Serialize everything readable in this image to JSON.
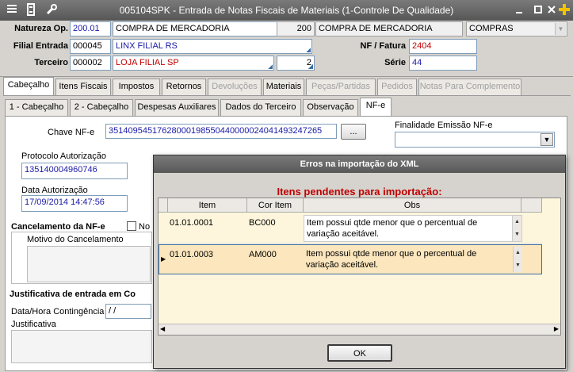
{
  "window": {
    "title": "005104SPK - Entrada de Notas Fiscais de Materiais (1-Controle De Qualidade)"
  },
  "header": {
    "natureza_label": "Natureza Op.",
    "natureza_code": "200.01",
    "natureza_desc": "COMPRA DE MERCADORIA",
    "natureza_num": "200",
    "natureza_desc2": "COMPRA DE MERCADORIA",
    "tipo_value": "COMPRAS",
    "filial_label": "Filial Entrada",
    "filial_code": "000045",
    "filial_name": "LINX FILIAL RS",
    "nf_label": "NF / Fatura",
    "nf_value": "2404",
    "terceiro_label": "Terceiro",
    "terceiro_code": "000002",
    "terceiro_name": "LOJA FILIAL SP",
    "terceiro_num": "2",
    "serie_label": "Série",
    "serie_value": "44"
  },
  "main_tabs": [
    {
      "label": "Cabeçalho"
    },
    {
      "label": "Itens Fiscais"
    },
    {
      "label": "Impostos"
    },
    {
      "label": "Retornos"
    },
    {
      "label": "Devoluções"
    },
    {
      "label": "Materiais"
    },
    {
      "label": "Peças/Partidas"
    },
    {
      "label": "Pedidos"
    },
    {
      "label": "Notas Para Complemento"
    }
  ],
  "sub_tabs": [
    {
      "label": "1 - Cabeçalho"
    },
    {
      "label": "2 - Cabeçalho"
    },
    {
      "label": "Despesas Auxiliares"
    },
    {
      "label": "Dados do Terceiro"
    },
    {
      "label": "Observação"
    },
    {
      "label": "NF-e"
    }
  ],
  "nfe": {
    "chave_label": "Chave NF-e",
    "chave_value": "35140954517628000198550440000024041493247265",
    "chave_button": "...",
    "finalidade_label": "Finalidade Emissão NF-e",
    "protocolo_label": "Protocolo Autorização",
    "protocolo_value": "135140004960746",
    "data_aut_label": "Data Autorização",
    "data_aut_value": "17/09/2014 14:47:56",
    "cancel_label": "Cancelamento da NF-e",
    "cancel_chk_label": "No",
    "motivo_label": "Motivo do Cancelamento",
    "justificativa_title": "Justificativa de entrada em Co",
    "contingencia_label": "Data/Hora Contingência",
    "contingencia_value": " / /",
    "justificativa_label": "Justificativa"
  },
  "dialog": {
    "title": "Erros na importação do XML",
    "heading": "Itens pendentes para importação:",
    "columns": [
      "Item",
      "Cor Item",
      "Obs"
    ],
    "rows": [
      {
        "item": "01.01.0001",
        "cor": "BC000",
        "obs": "Item possui qtde menor que o percentual de variação aceitável."
      },
      {
        "item": "01.01.0003",
        "cor": "AM000",
        "obs": "Item possui qtde menor que o percentual de variação aceitável."
      }
    ],
    "ok_label": "OK"
  }
}
